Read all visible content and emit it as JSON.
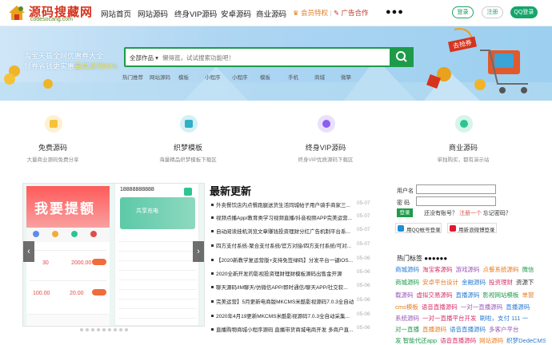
{
  "logo": {
    "title": "源码搜藏网",
    "domain": "codesocang.com"
  },
  "nav": {
    "items": [
      "网站首页",
      "网站源码",
      "终身VIP源码",
      "安卓源码",
      "商业源码"
    ],
    "vip": "会员特权",
    "ad": "广告合作",
    "more": "●●●",
    "login": "登录",
    "register": "注册",
    "qq_login": "QQ登录"
  },
  "banner": {
    "slogan_1": "淘宝天猫全网优惠券大全",
    "slogan_2a": "领券省钱更实惠",
    "slogan_2b": "最高返利90%",
    "badge": "去抢券",
    "category": "全部作品",
    "placeholder": "懒得逛，试试搜索功能吧！",
    "hot": [
      "热门推荐",
      "网站源码",
      "模板",
      "小程序",
      "小程序",
      "模板",
      "手机",
      "商城",
      "微擎"
    ]
  },
  "features": [
    {
      "title": "免费源码",
      "desc": "大量商业源码免费分享",
      "icon": "free-code-icon",
      "color": "#f5c23a"
    },
    {
      "title": "织梦模板",
      "desc": "海量精品织梦模板下载区",
      "icon": "dede-template-icon",
      "color": "#2fb0c6"
    },
    {
      "title": "终身VIP源码",
      "desc": "终身VIP优质源码下载区",
      "icon": "vip-code-icon",
      "color": "#8b5cf6"
    },
    {
      "title": "商业源码",
      "desc": "单独购买，都有演示站",
      "icon": "business-code-icon",
      "color": "#2dc58f"
    }
  ],
  "slider": {
    "phone": "18888888888",
    "title": "我要提额",
    "share": "共享充电",
    "stats": [
      "30",
      "2000.00",
      "100.00",
      "20.00"
    ]
  },
  "news": {
    "title": "最新更新",
    "items": [
      {
        "t": "外卖餐饮店内点餐跑腿送货生活同城帖子用户骑手商家三...",
        "d": "05-07"
      },
      {
        "t": "视频点播App/教育类学习视频直播/抖音视频APP完美运营...",
        "d": "05-07"
      },
      {
        "t": "自动阅读挂机浏览文章赚钱投资理财分红广告机制平台系...",
        "d": "05-07"
      },
      {
        "t": "四方支付系统-聚合支付系统/官方对接/四方支付系统/可对...",
        "d": "05-07"
      },
      {
        "t": "【2020新教学复运营版+支持免签绿码】分发平台一键iOS...",
        "d": "05-06"
      },
      {
        "t": "2020全新开发的影视投资理财理财模板源码出售金开源",
        "d": "05-06"
      },
      {
        "t": "聊天源码/IM聊天/仿微信APP/即时通信/聊天APP/社交软...",
        "d": "05-06"
      },
      {
        "t": "完美运营】5月更新电商版MKCMS米酷影视源码7.0.3全自动采集...",
        "d": "05-06"
      },
      {
        "t": "2020年4月19更新MKCMS米酷影视源码7.0.3全自动采集...",
        "d": "05-06"
      },
      {
        "t": "直播购物商城小程序源码 直播带货商城电商开发 多商户直...",
        "d": "05-06"
      }
    ]
  },
  "account": {
    "user_label": "用户名",
    "pwd_label": "密 码",
    "submit": "登录",
    "forget": "还没有账号？",
    "reg": "注册一个",
    "forget_pwd": "忘记密码？",
    "qq_btn": "用QQ帐号登录",
    "weibo_btn": "用新浪微博登录"
  },
  "tags": {
    "title": "热门标签 ●●●●●●",
    "items": [
      {
        "t": "商城源码",
        "c": "#2b7bd1"
      },
      {
        "t": "淘宝客源码",
        "c": "#d6336c"
      },
      {
        "t": "游戏源码",
        "c": "#9b59b6"
      },
      {
        "t": "点餐系统源码",
        "c": "#e67e22"
      },
      {
        "t": "微信",
        "c": "#1e9b4a"
      },
      {
        "t": "商城源码",
        "c": "#1e9b4a"
      },
      {
        "t": "安卓平台设计",
        "c": "#e67e22"
      },
      {
        "t": "金融源码",
        "c": "#2b7bd1"
      },
      {
        "t": "投资理财",
        "c": "#d6336c"
      },
      {
        "t": "资源下",
        "c": "#333"
      },
      {
        "t": "载源码",
        "c": "#9b59b6"
      },
      {
        "t": "虚拟交易源码",
        "c": "#d6336c"
      },
      {
        "t": "直播源码",
        "c": "#2b7bd1"
      },
      {
        "t": "影视网站模板",
        "c": "#1e9b4a"
      },
      {
        "t": "单窗",
        "c": "#e67e22"
      },
      {
        "t": "cms模板",
        "c": "#e67e22"
      },
      {
        "t": "语音直播源码",
        "c": "#d6336c"
      },
      {
        "t": "一对一直播源码",
        "c": "#9b59b6"
      },
      {
        "t": "直播源码",
        "c": "#2b7bd1"
      },
      {
        "t": "系统源码",
        "c": "#9b59b6"
      },
      {
        "t": "一对一直播平台开发",
        "c": "#d6336c"
      },
      {
        "t": "刷啦，支付 111 一",
        "c": "#2b7bd1"
      },
      {
        "t": "对一直播",
        "c": "#1e9b4a"
      },
      {
        "t": "直播源码",
        "c": "#e67e22"
      },
      {
        "t": "语音直播源码",
        "c": "#2b7bd1"
      },
      {
        "t": "多客户平台",
        "c": "#9b59b6"
      },
      {
        "t": "发 智能代还app",
        "c": "#1e9b4a"
      },
      {
        "t": "语音直播源码",
        "c": "#d6336c"
      },
      {
        "t": "网站源码",
        "c": "#e67e22"
      },
      {
        "t": "织梦DedeCMS 2",
        "c": "#2b7bd1"
      }
    ]
  }
}
